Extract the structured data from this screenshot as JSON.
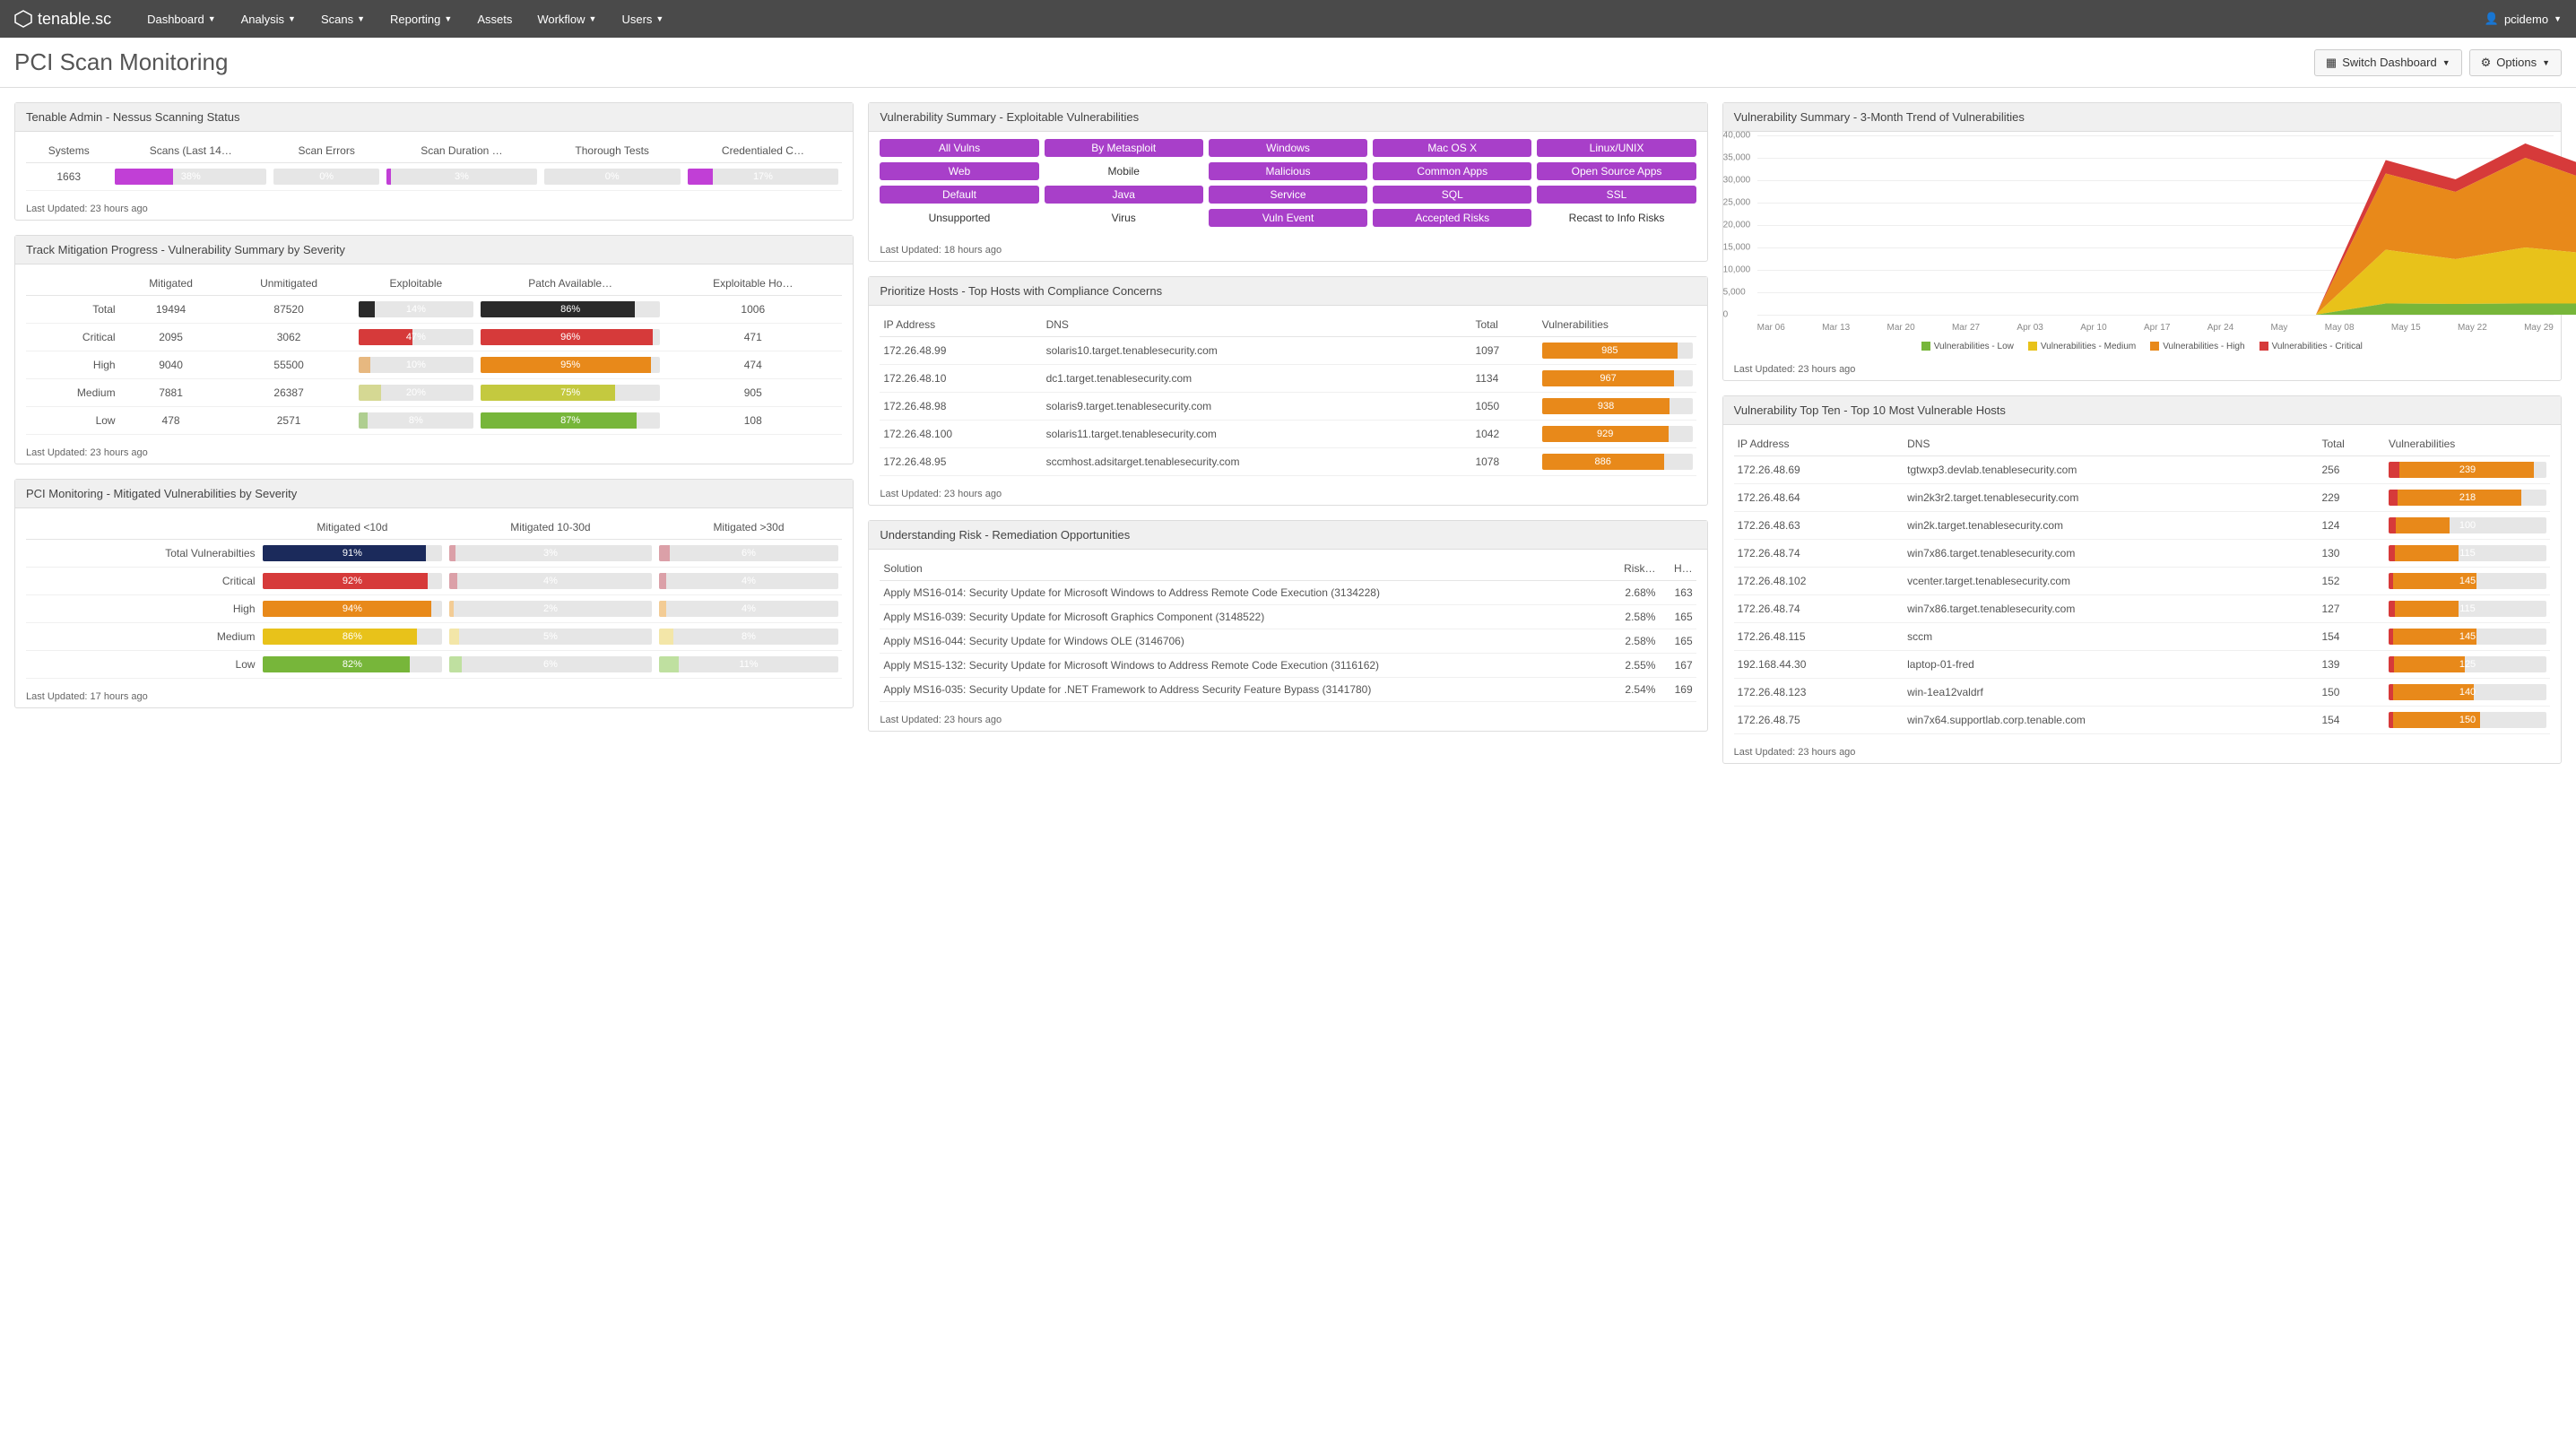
{
  "nav": {
    "brand": "tenable",
    "brand_suffix": ".sc",
    "items": [
      "Dashboard",
      "Analysis",
      "Scans",
      "Reporting",
      "Assets",
      "Workflow",
      "Users"
    ],
    "has_caret": [
      true,
      true,
      true,
      true,
      false,
      true,
      true
    ],
    "user": "pcidemo"
  },
  "page": {
    "title": "PCI Scan Monitoring",
    "switch": "Switch Dashboard",
    "options": "Options"
  },
  "colors": {
    "magenta": "#c13fd6",
    "navy": "#1b2a5b",
    "red": "#d63a3a",
    "orange": "#e8891a",
    "yellow": "#e8c21a",
    "olive": "#c4c93f",
    "green": "#77b63a",
    "dark": "#2a2a2a",
    "pink": "#dba0a8",
    "ltorange": "#f3cc95",
    "ltyellow": "#f3e6a8",
    "ltgreen": "#bfe0a0",
    "grey": "#e6e6e6"
  },
  "p1": {
    "title": "Tenable Admin - Nessus Scanning Status",
    "cols": [
      "Systems",
      "Scans (Last 14…",
      "Scan Errors",
      "Scan Duration …",
      "Thorough Tests",
      "Credentialed C…"
    ],
    "systems": "1663",
    "bars": [
      {
        "pct": 38,
        "label": "38%",
        "color": "magenta"
      },
      {
        "pct": 0,
        "label": "0%",
        "color": "magenta"
      },
      {
        "pct": 3,
        "label": "3%",
        "color": "magenta"
      },
      {
        "pct": 0,
        "label": "0%",
        "color": "magenta"
      },
      {
        "pct": 17,
        "label": "17%",
        "color": "magenta"
      }
    ],
    "updated": "Last Updated: 23 hours ago"
  },
  "p2": {
    "title": "Track Mitigation Progress - Vulnerability Summary by Severity",
    "cols": [
      "",
      "Mitigated",
      "Unmitigated",
      "Exploitable",
      "Patch Available…",
      "Exploitable Ho…"
    ],
    "rows": [
      {
        "label": "Total",
        "mit": "19494",
        "unmit": "87520",
        "expl": {
          "pct": 14,
          "c": "dark"
        },
        "patch": {
          "pct": 86,
          "c": "dark"
        },
        "hosts": "1006"
      },
      {
        "label": "Critical",
        "mit": "2095",
        "unmit": "3062",
        "expl": {
          "pct": 47,
          "c": "red"
        },
        "patch": {
          "pct": 96,
          "c": "red"
        },
        "hosts": "471"
      },
      {
        "label": "High",
        "mit": "9040",
        "unmit": "55500",
        "expl": {
          "pct": 10,
          "c": "orange",
          "muted": true
        },
        "patch": {
          "pct": 95,
          "c": "orange"
        },
        "hosts": "474"
      },
      {
        "label": "Medium",
        "mit": "7881",
        "unmit": "26387",
        "expl": {
          "pct": 20,
          "c": "olive",
          "muted": true
        },
        "patch": {
          "pct": 75,
          "c": "olive"
        },
        "hosts": "905"
      },
      {
        "label": "Low",
        "mit": "478",
        "unmit": "2571",
        "expl": {
          "pct": 8,
          "c": "green",
          "muted": true
        },
        "patch": {
          "pct": 87,
          "c": "green"
        },
        "hosts": "108"
      }
    ],
    "updated": "Last Updated: 23 hours ago"
  },
  "p3": {
    "title": "PCI Monitoring - Mitigated Vulnerabilities by Severity",
    "cols": [
      "",
      "Mitigated <10d",
      "Mitigated 10-30d",
      "Mitigated >30d"
    ],
    "rows": [
      {
        "label": "Total Vulnerabilties",
        "a": {
          "pct": 91,
          "c": "navy"
        },
        "b": {
          "pct": 3,
          "c": "pink"
        },
        "c": {
          "pct": 6,
          "c": "pink"
        }
      },
      {
        "label": "Critical",
        "a": {
          "pct": 92,
          "c": "red"
        },
        "b": {
          "pct": 4,
          "c": "pink"
        },
        "c": {
          "pct": 4,
          "c": "pink"
        }
      },
      {
        "label": "High",
        "a": {
          "pct": 94,
          "c": "orange"
        },
        "b": {
          "pct": 2,
          "c": "ltorange"
        },
        "c": {
          "pct": 4,
          "c": "ltorange"
        }
      },
      {
        "label": "Medium",
        "a": {
          "pct": 86,
          "c": "yellow"
        },
        "b": {
          "pct": 5,
          "c": "ltyellow"
        },
        "c": {
          "pct": 8,
          "c": "ltyellow"
        }
      },
      {
        "label": "Low",
        "a": {
          "pct": 82,
          "c": "green"
        },
        "b": {
          "pct": 6,
          "c": "ltgreen"
        },
        "c": {
          "pct": 11,
          "c": "ltgreen"
        }
      }
    ],
    "updated": "Last Updated: 17 hours ago"
  },
  "p4": {
    "title": "Vulnerability Summary - Exploitable Vulnerabilities",
    "grid": [
      [
        "All Vulns",
        "By Metasploit",
        "Windows",
        "Mac OS X",
        "Linux/UNIX"
      ],
      [
        "Web",
        "Mobile",
        "Malicious",
        "Common Apps",
        "Open Source Apps"
      ],
      [
        "Default",
        "Java",
        "Service",
        "SQL",
        "SSL"
      ],
      [
        "Unsupported",
        "Virus",
        "Vuln Event",
        "Accepted Risks",
        "Recast to Info Risks"
      ]
    ],
    "plain": {
      "Mobile": true,
      "Unsupported": true,
      "Virus": true,
      "Recast to Info Risks": true
    },
    "updated": "Last Updated: 18 hours ago"
  },
  "p5": {
    "title": "Prioritize Hosts - Top Hosts with Compliance Concerns",
    "cols": [
      "IP Address",
      "DNS",
      "Total",
      "Vulnerabilities"
    ],
    "rows": [
      {
        "ip": "172.26.48.99",
        "dns": "solaris10.target.tenablesecurity.com",
        "total": "1097",
        "v": 985,
        "max": 1100
      },
      {
        "ip": "172.26.48.10",
        "dns": "dc1.target.tenablesecurity.com",
        "total": "1134",
        "v": 967,
        "max": 1100
      },
      {
        "ip": "172.26.48.98",
        "dns": "solaris9.target.tenablesecurity.com",
        "total": "1050",
        "v": 938,
        "max": 1100
      },
      {
        "ip": "172.26.48.100",
        "dns": "solaris11.target.tenablesecurity.com",
        "total": "1042",
        "v": 929,
        "max": 1100
      },
      {
        "ip": "172.26.48.95",
        "dns": "sccmhost.adsitarget.tenablesecurity.com",
        "total": "1078",
        "v": 886,
        "max": 1100
      }
    ],
    "updated": "Last Updated: 23 hours ago"
  },
  "p6": {
    "title": "Understanding Risk - Remediation Opportunities",
    "cols": [
      "Solution",
      "Risk…",
      "H…"
    ],
    "rows": [
      {
        "s": "Apply MS16-014: Security Update for Microsoft Windows to Address Remote Code Execution (3134228)",
        "r": "2.68%",
        "h": "163"
      },
      {
        "s": "Apply MS16-039: Security Update for Microsoft Graphics Component (3148522)",
        "r": "2.58%",
        "h": "165"
      },
      {
        "s": "Apply MS16-044: Security Update for Windows OLE (3146706)",
        "r": "2.58%",
        "h": "165"
      },
      {
        "s": "Apply MS15-132: Security Update for Microsoft Windows to Address Remote Code Execution (3116162)",
        "r": "2.55%",
        "h": "167"
      },
      {
        "s": "Apply MS16-035: Security Update for .NET Framework to Address Security Feature Bypass (3141780)",
        "r": "2.54%",
        "h": "169"
      }
    ],
    "updated": "Last Updated: 23 hours ago"
  },
  "p7": {
    "title": "Vulnerability Summary - 3-Month Trend of Vulnerabilities",
    "chart_data": {
      "type": "area",
      "ylim": [
        0,
        40000
      ],
      "yticks": [
        0,
        5000,
        10000,
        15000,
        20000,
        25000,
        30000,
        35000,
        40000
      ],
      "categories": [
        "Mar 06",
        "Mar 13",
        "Mar 20",
        "Mar 27",
        "Apr 03",
        "Apr 10",
        "Apr 17",
        "Apr 24",
        "May",
        "May 08",
        "May 15",
        "May 22",
        "May 29"
      ],
      "series": [
        {
          "name": "Vulnerabilities - Low",
          "color": "#77b63a",
          "values": [
            0,
            0,
            0,
            0,
            0,
            0,
            0,
            0,
            0,
            2500,
            2400,
            2500,
            2500
          ]
        },
        {
          "name": "Vulnerabilities - Medium",
          "color": "#e8c21a",
          "values": [
            0,
            0,
            0,
            0,
            0,
            0,
            0,
            0,
            0,
            12000,
            10000,
            12500,
            11000
          ]
        },
        {
          "name": "Vulnerabilities - High",
          "color": "#e8891a",
          "values": [
            0,
            0,
            0,
            0,
            0,
            0,
            0,
            0,
            0,
            17000,
            15000,
            20000,
            16000
          ]
        },
        {
          "name": "Vulnerabilities - Critical",
          "color": "#d63a3a",
          "values": [
            0,
            0,
            0,
            0,
            0,
            0,
            0,
            0,
            0,
            3000,
            2800,
            3200,
            3000
          ]
        }
      ],
      "peaks": [
        {
          "x": 10,
          "total": 38000
        },
        {
          "x": 11,
          "total": 34000
        },
        {
          "x": 12,
          "total": 36000
        }
      ]
    },
    "updated": "Last Updated: 23 hours ago"
  },
  "p8": {
    "title": "Vulnerability Top Ten - Top 10 Most Vulnerable Hosts",
    "cols": [
      "IP Address",
      "DNS",
      "Total",
      "Vulnerabilities"
    ],
    "rows": [
      {
        "ip": "172.26.48.69",
        "dns": "tgtwxp3.devlab.tenablesecurity.com",
        "total": "256",
        "v": 239,
        "crit": 18,
        "max": 260
      },
      {
        "ip": "172.26.48.64",
        "dns": "win2k3r2.target.tenablesecurity.com",
        "total": "229",
        "v": 218,
        "crit": 15,
        "max": 260
      },
      {
        "ip": "172.26.48.63",
        "dns": "win2k.target.tenablesecurity.com",
        "total": "124",
        "v": 100,
        "crit": 12,
        "max": 260
      },
      {
        "ip": "172.26.48.74",
        "dns": "win7x86.target.tenablesecurity.com",
        "total": "130",
        "v": 115,
        "crit": 10,
        "max": 260
      },
      {
        "ip": "172.26.48.102",
        "dns": "vcenter.target.tenablesecurity.com",
        "total": "152",
        "v": 145,
        "crit": 8,
        "max": 260
      },
      {
        "ip": "172.26.48.74",
        "dns": "win7x86.target.tenablesecurity.com",
        "total": "127",
        "v": 115,
        "crit": 10,
        "max": 260
      },
      {
        "ip": "172.26.48.115",
        "dns": "sccm",
        "total": "154",
        "v": 145,
        "crit": 8,
        "max": 260
      },
      {
        "ip": "192.168.44.30",
        "dns": "laptop-01-fred",
        "total": "139",
        "v": 125,
        "crit": 9,
        "max": 260
      },
      {
        "ip": "172.26.48.123",
        "dns": "win-1ea12valdrf",
        "total": "150",
        "v": 140,
        "crit": 8,
        "max": 260
      },
      {
        "ip": "172.26.48.75",
        "dns": "win7x64.supportlab.corp.tenable.com",
        "total": "154",
        "v": 150,
        "crit": 8,
        "max": 260
      }
    ],
    "updated": "Last Updated: 23 hours ago"
  }
}
